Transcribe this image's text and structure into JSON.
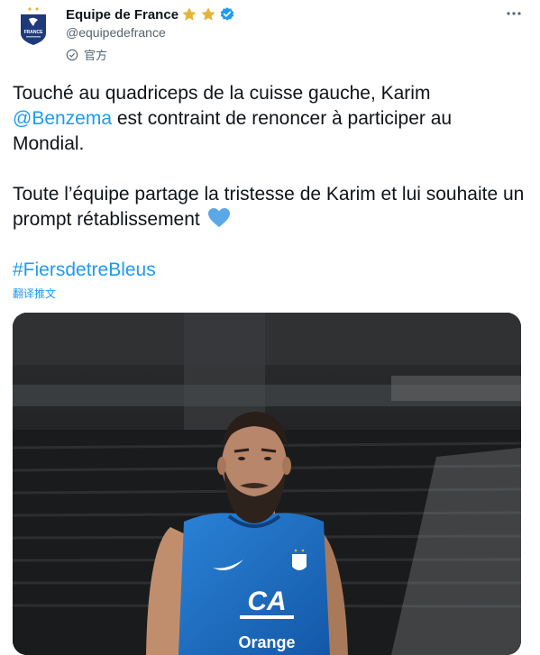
{
  "author": {
    "display_name": "Equipe de France",
    "handle": "@equipedefrance",
    "label": "官方",
    "avatar_text": "FRANCE"
  },
  "tweet": {
    "line1_start": "Touché au quadriceps de la cuisse gauche, Karim",
    "mention": "@Benzema",
    "line1_end": " est contraint de renoncer à participer au Mondial.",
    "line2": "Toute l’équipe partage la tristesse de Karim et lui souhaite un prompt rétablissement ",
    "hashtag": "#FiersdetreBleus",
    "translate": "翻译推文"
  },
  "media": {
    "sponsor_text": "CA",
    "sponsor_sub": "Orange"
  },
  "colors": {
    "accent": "#1d9bf0",
    "heart": "#5ba8e8",
    "star": "#e5b53b",
    "shirt": "#1a72c8"
  },
  "icons": [
    "star-icon",
    "verified-icon",
    "official-label-icon",
    "more-icon",
    "heart-icon"
  ]
}
